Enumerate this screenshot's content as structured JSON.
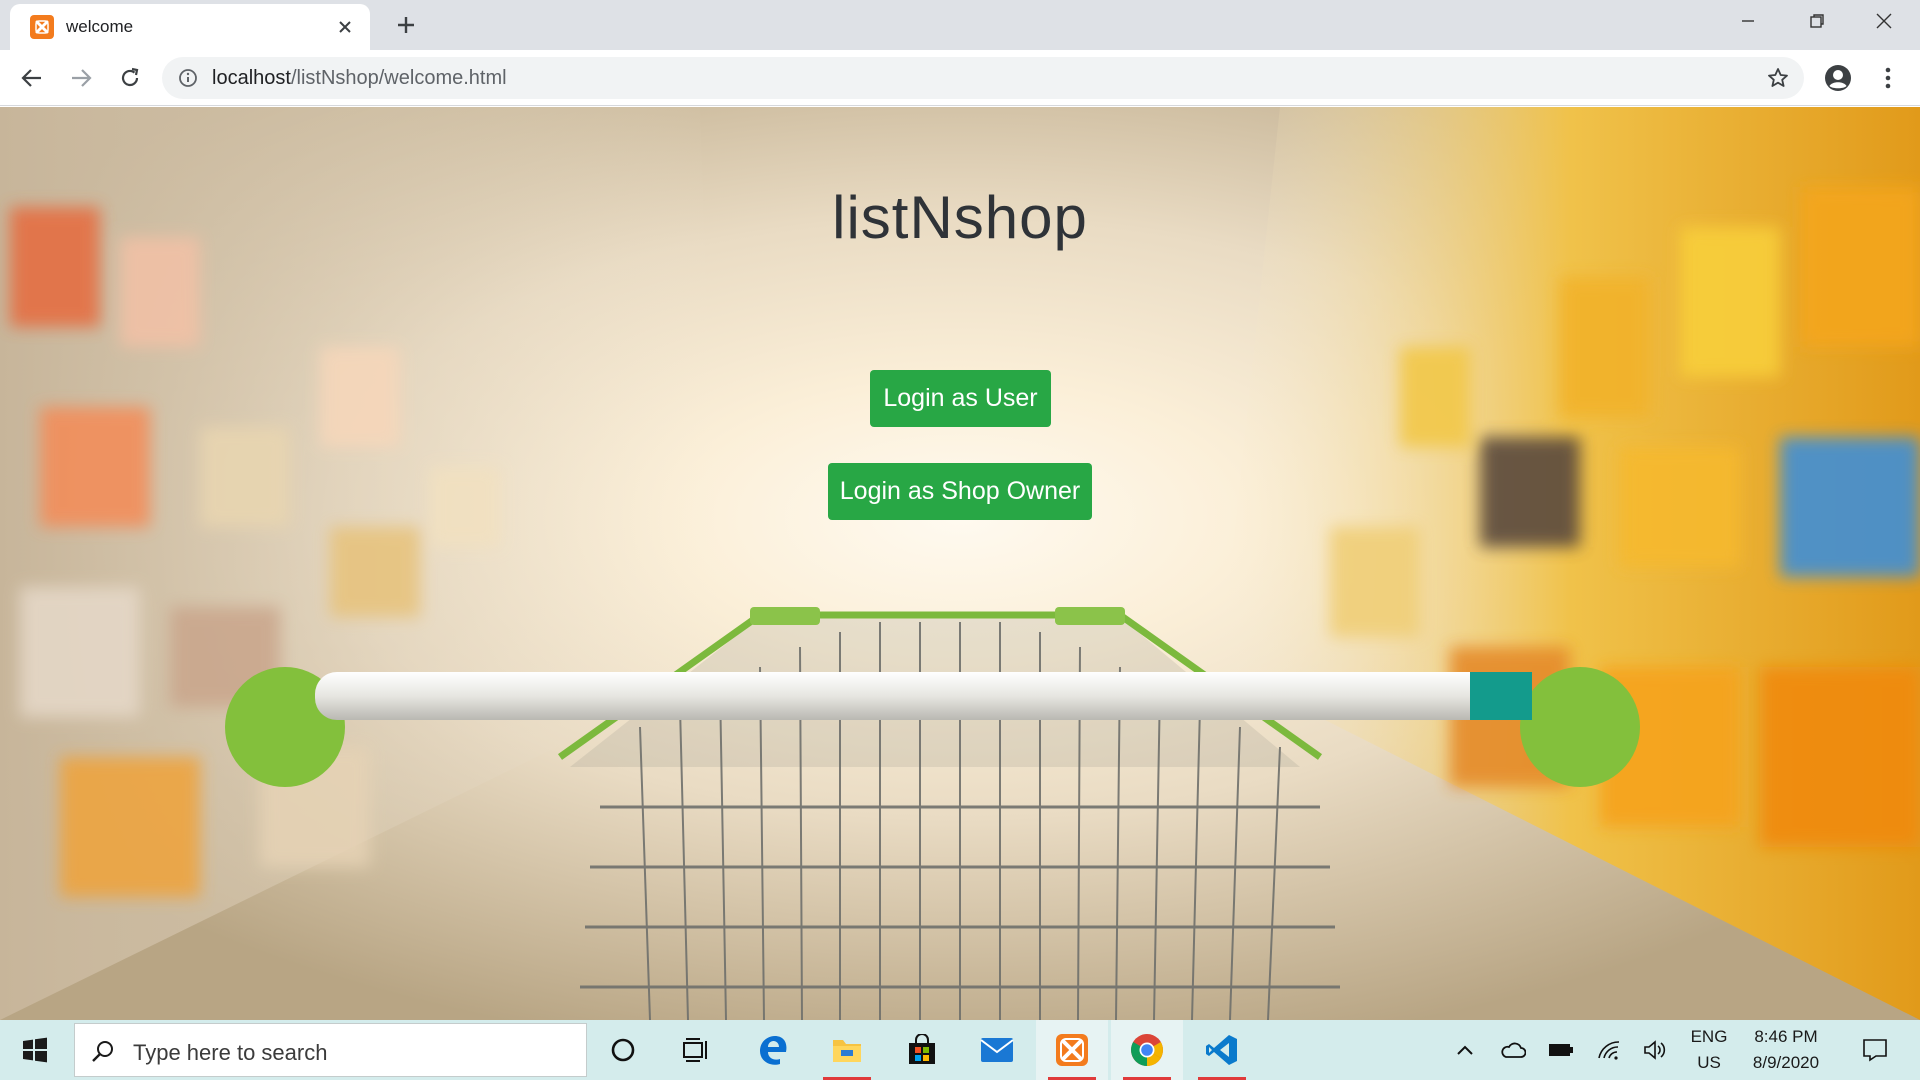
{
  "browser": {
    "tab_title": "welcome",
    "url_host": "localhost",
    "url_path": "/listNshop/welcome.html"
  },
  "page": {
    "site_title": "listNshop",
    "login_user_label": "Login as User",
    "login_owner_label": "Login as Shop Owner",
    "button_color": "#28a745"
  },
  "taskbar": {
    "search_placeholder": "Type here to search",
    "pinned": [
      "cortana-icon",
      "task-view-icon",
      "edge-icon",
      "file-explorer-icon",
      "store-icon",
      "mail-icon",
      "xampp-icon",
      "chrome-icon",
      "vscode-icon"
    ],
    "lang_top": "ENG",
    "lang_bottom": "US",
    "time": "8:46 PM",
    "date": "8/9/2020"
  }
}
